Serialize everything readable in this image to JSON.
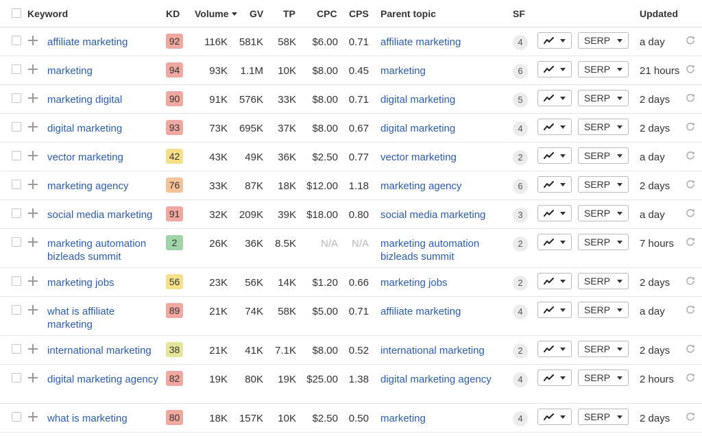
{
  "header": {
    "keyword": "Keyword",
    "kd": "KD",
    "volume": "Volume",
    "gv": "GV",
    "tp": "TP",
    "cpc": "CPC",
    "cps": "CPS",
    "parent_topic": "Parent topic",
    "sf": "SF",
    "updated": "Updated"
  },
  "colors": {
    "kd_high": "#f0a8a0",
    "kd_medium_high": "#f5c29a",
    "kd_medium": "#f7e08a",
    "kd_low_medium": "#e6e69a",
    "kd_low": "#9fd3a8",
    "link": "#2a5db0"
  },
  "icons": {
    "trend": "trend-line-icon",
    "refresh": "refresh-icon",
    "add": "plus-icon"
  },
  "rows": [
    {
      "keyword": "affiliate marketing",
      "kd": "92",
      "kd_color": "#f0a8a0",
      "volume": "116K",
      "gv": "581K",
      "tp": "58K",
      "cpc": "$6.00",
      "cps": "0.71",
      "parent": "affiliate marketing",
      "sf": "4",
      "serp": "SERP",
      "updated": "a day"
    },
    {
      "keyword": "marketing",
      "kd": "94",
      "kd_color": "#f0a8a0",
      "volume": "93K",
      "gv": "1.1M",
      "tp": "10K",
      "cpc": "$8.00",
      "cps": "0.45",
      "parent": "marketing",
      "sf": "6",
      "serp": "SERP",
      "updated": "21 hours"
    },
    {
      "keyword": "marketing digital",
      "kd": "90",
      "kd_color": "#f0a8a0",
      "volume": "91K",
      "gv": "576K",
      "tp": "33K",
      "cpc": "$8.00",
      "cps": "0.71",
      "parent": "digital marketing",
      "sf": "5",
      "serp": "SERP",
      "updated": "2 days"
    },
    {
      "keyword": "digital marketing",
      "kd": "93",
      "kd_color": "#f0a8a0",
      "volume": "73K",
      "gv": "695K",
      "tp": "37K",
      "cpc": "$8.00",
      "cps": "0.67",
      "parent": "digital marketing",
      "sf": "4",
      "serp": "SERP",
      "updated": "2 days"
    },
    {
      "keyword": "vector marketing",
      "kd": "42",
      "kd_color": "#f7e08a",
      "volume": "43K",
      "gv": "49K",
      "tp": "36K",
      "cpc": "$2.50",
      "cps": "0.77",
      "parent": "vector marketing",
      "sf": "2",
      "serp": "SERP",
      "updated": "a day"
    },
    {
      "keyword": "marketing agency",
      "kd": "76",
      "kd_color": "#f5c29a",
      "volume": "33K",
      "gv": "87K",
      "tp": "18K",
      "cpc": "$12.00",
      "cps": "1.18",
      "parent": "marketing agency",
      "sf": "6",
      "serp": "SERP",
      "updated": "2 days"
    },
    {
      "keyword": "social media marketing",
      "kd": "91",
      "kd_color": "#f0a8a0",
      "volume": "32K",
      "gv": "209K",
      "tp": "39K",
      "cpc": "$18.00",
      "cps": "0.80",
      "parent": "social media marketing",
      "sf": "3",
      "serp": "SERP",
      "updated": "a day"
    },
    {
      "keyword": "marketing automation bizleads summit",
      "kd": "2",
      "kd_color": "#9fd3a8",
      "volume": "26K",
      "gv": "36K",
      "tp": "8.5K",
      "cpc": "N/A",
      "cps": "N/A",
      "parent": "marketing automation bizleads summit",
      "sf": "2",
      "serp": "SERP",
      "updated": "7 hours",
      "tall": true
    },
    {
      "keyword": "marketing jobs",
      "kd": "56",
      "kd_color": "#f7e08a",
      "volume": "23K",
      "gv": "56K",
      "tp": "14K",
      "cpc": "$1.20",
      "cps": "0.66",
      "parent": "marketing jobs",
      "sf": "2",
      "serp": "SERP",
      "updated": "2 days"
    },
    {
      "keyword": "what is affiliate marketing",
      "kd": "89",
      "kd_color": "#f0a8a0",
      "volume": "21K",
      "gv": "74K",
      "tp": "58K",
      "cpc": "$5.00",
      "cps": "0.71",
      "parent": "affiliate marketing",
      "sf": "4",
      "serp": "SERP",
      "updated": "a day",
      "tall": true
    },
    {
      "keyword": "international marketing",
      "kd": "38",
      "kd_color": "#e6e69a",
      "volume": "21K",
      "gv": "41K",
      "tp": "7.1K",
      "cpc": "$8.00",
      "cps": "0.52",
      "parent": "international marketing",
      "sf": "2",
      "serp": "SERP",
      "updated": "2 days"
    },
    {
      "keyword": "digital marketing agency",
      "kd": "82",
      "kd_color": "#f0a8a0",
      "volume": "19K",
      "gv": "80K",
      "tp": "19K",
      "cpc": "$25.00",
      "cps": "1.38",
      "parent": "digital marketing agency",
      "sf": "4",
      "serp": "SERP",
      "updated": "2 hours",
      "tall": true
    },
    {
      "keyword": "what is marketing",
      "kd": "80",
      "kd_color": "#f0a8a0",
      "volume": "18K",
      "gv": "157K",
      "tp": "10K",
      "cpc": "$2.50",
      "cps": "0.50",
      "parent": "marketing",
      "sf": "4",
      "serp": "SERP",
      "updated": "2 days"
    }
  ]
}
